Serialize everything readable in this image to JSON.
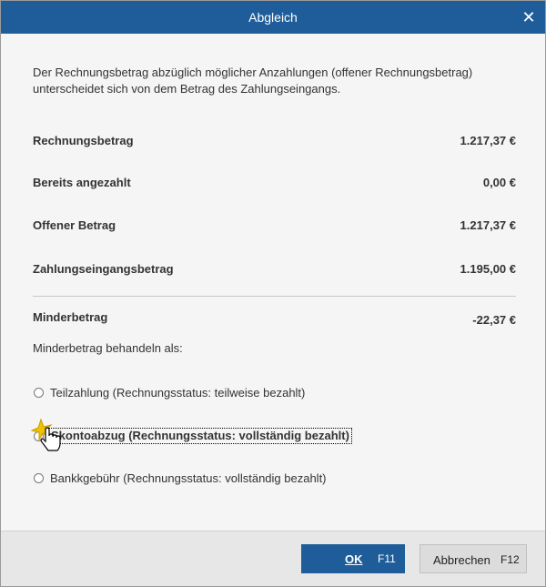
{
  "window": {
    "title": "Abgleich",
    "close_glyph": "✕"
  },
  "message": "Der Rechnungsbetrag abzüglich möglicher Anzahlungen (offener Rechnungsbetrag) unterscheidet sich von dem Betrag des Zahlungseingangs.",
  "amounts": [
    {
      "label": "Rechnungsbetrag",
      "value": "1.217,37 €"
    },
    {
      "label": "Bereits angezahlt",
      "value": "0,00 €"
    },
    {
      "label": "Offener Betrag",
      "value": "1.217,37 €"
    },
    {
      "label": "Zahlungseingangsbetrag",
      "value": "1.195,00 €"
    }
  ],
  "difference": {
    "label": "Minderbetrag",
    "value": "-22,37 €"
  },
  "handle_label": "Minderbetrag behandeln als:",
  "options": [
    {
      "label": "Teilzahlung (Rechnungsstatus: teilweise bezahlt)",
      "selected": false
    },
    {
      "label": "Skontoabzug (Rechnungsstatus: vollständig bezahlt)",
      "selected": true
    },
    {
      "label": "Bankkgebühr (Rechnungsstatus: vollständig bezahlt)",
      "selected": false
    }
  ],
  "buttons": {
    "ok": {
      "label": "OK",
      "shortcut": "F11"
    },
    "cancel": {
      "label": "Abbrechen",
      "shortcut": "F12"
    }
  },
  "colors": {
    "titlebar": "#1f5d9a",
    "ok_button": "#1f5d9a",
    "highlight": "#f2c200"
  },
  "icons": {
    "close": "close-icon",
    "cursor": "hand-pointer-icon"
  }
}
